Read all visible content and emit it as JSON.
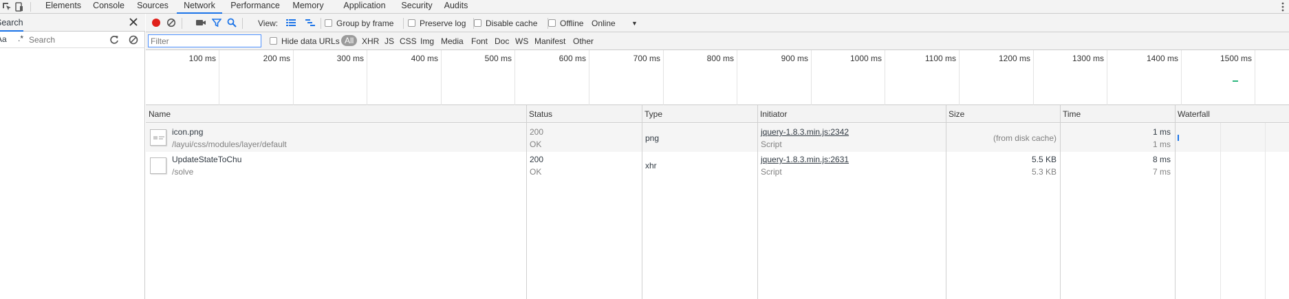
{
  "main_tabs": [
    {
      "label": "Elements"
    },
    {
      "label": "Console"
    },
    {
      "label": "Sources"
    },
    {
      "label": "Network"
    },
    {
      "label": "Performance"
    },
    {
      "label": "Memory"
    },
    {
      "label": "Application"
    },
    {
      "label": "Security"
    },
    {
      "label": "Audits"
    }
  ],
  "active_tab": "Network",
  "drawer": {
    "tab_label": "Search",
    "case_label": "Aa",
    "regex_label": ".*",
    "search_placeholder": "Search"
  },
  "toolbar": {
    "view_label": "View:",
    "group_by_frame": "Group by frame",
    "preserve_log": "Preserve log",
    "disable_cache": "Disable cache",
    "offline": "Offline",
    "throttle": "Online"
  },
  "filterbar": {
    "filter_placeholder": "Filter",
    "hide_data_urls": "Hide data URLs",
    "types": [
      "All",
      "XHR",
      "JS",
      "CSS",
      "Img",
      "Media",
      "Font",
      "Doc",
      "WS",
      "Manifest",
      "Other"
    ]
  },
  "overview": {
    "ticks": [
      "100 ms",
      "200 ms",
      "300 ms",
      "400 ms",
      "500 ms",
      "600 ms",
      "700 ms",
      "800 ms",
      "900 ms",
      "1000 ms",
      "1100 ms",
      "1200 ms",
      "1300 ms",
      "1400 ms",
      "1500 ms"
    ]
  },
  "columns": [
    "Name",
    "Status",
    "Type",
    "Initiator",
    "Size",
    "Time",
    "Waterfall"
  ],
  "requests": [
    {
      "name": "icon.png",
      "path": "/layui/css/modules/layer/default",
      "status": "200",
      "status_text": "OK",
      "type": "png",
      "initiator": "jquery-1.8.3.min.js:2342",
      "initiator_type": "Script",
      "size": "(from disk cache)",
      "size_sub": "",
      "time": "1 ms",
      "time_sub": "1 ms"
    },
    {
      "name": "UpdateStateToChu",
      "path": "/solve",
      "status": "200",
      "status_text": "OK",
      "type": "xhr",
      "initiator": "jquery-1.8.3.min.js:2631",
      "initiator_type": "Script",
      "size": "5.5 KB",
      "size_sub": "5.3 KB",
      "time": "8 ms",
      "time_sub": "7 ms"
    }
  ],
  "colors": {
    "accent": "#1a73e8",
    "record": "#e0201a",
    "filter_active": "#1a73e8",
    "overview_bar": "#2cb67d"
  }
}
